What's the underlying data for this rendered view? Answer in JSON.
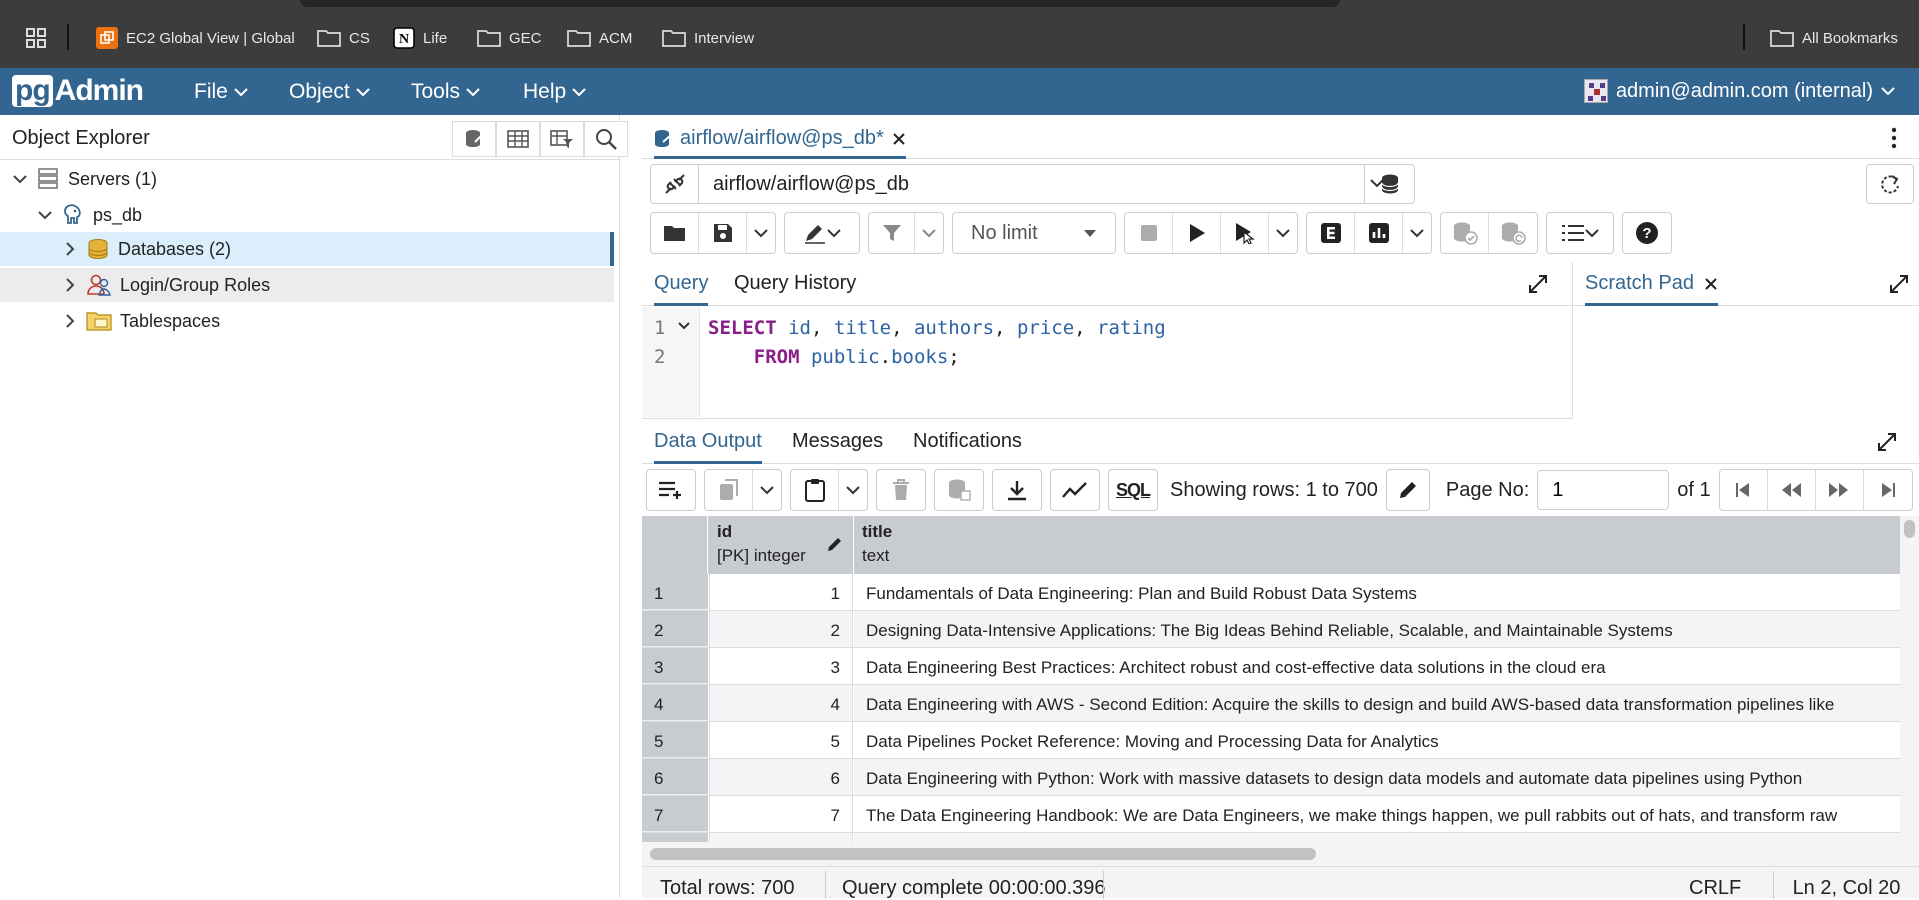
{
  "bookmarks": {
    "items": [
      {
        "label": "EC2 Global View | Global"
      },
      {
        "label": "CS"
      },
      {
        "label": "Life"
      },
      {
        "label": "GEC"
      },
      {
        "label": "ACM"
      },
      {
        "label": "Interview"
      }
    ],
    "all_bookmarks": "All Bookmarks"
  },
  "header": {
    "logo_pg": "pg",
    "logo_admin": "Admin",
    "menus": [
      "File",
      "Object",
      "Tools",
      "Help"
    ],
    "user": "admin@admin.com (internal)"
  },
  "explorer": {
    "title": "Object Explorer",
    "tree": {
      "servers": "Servers (1)",
      "server": "ps_db",
      "databases": "Databases (2)",
      "roles": "Login/Group Roles",
      "tablespaces": "Tablespaces"
    }
  },
  "query_tool": {
    "tab_title": "airflow/airflow@ps_db*",
    "connection": "airflow/airflow@ps_db",
    "limit": "No limit",
    "tabs": {
      "query": "Query",
      "history": "Query History",
      "scratch": "Scratch Pad"
    },
    "code": {
      "line1": {
        "num": "1",
        "kw": "SELECT",
        "cols": [
          "id",
          "title",
          "authors",
          "price",
          "rating"
        ]
      },
      "line2": {
        "num": "2",
        "kw": "FROM",
        "schema": "public",
        "table": "books"
      }
    }
  },
  "results": {
    "tabs": {
      "data": "Data Output",
      "messages": "Messages",
      "notifications": "Notifications"
    },
    "sql_label": "SQL",
    "showing": "Showing rows: 1 to 700",
    "page_label": "Page No:",
    "page_value": "1",
    "of": "of 1",
    "columns": [
      {
        "name": "id",
        "type": "[PK] integer"
      },
      {
        "name": "title",
        "type": "text"
      }
    ],
    "rows": [
      {
        "n": "1",
        "id": "1",
        "title": "Fundamentals of Data Engineering: Plan and Build Robust Data Systems"
      },
      {
        "n": "2",
        "id": "2",
        "title": "Designing Data-Intensive Applications: The Big Ideas Behind Reliable, Scalable, and Maintainable Systems"
      },
      {
        "n": "3",
        "id": "3",
        "title": "Data Engineering Best Practices: Architect robust and cost-effective data solutions in the cloud era"
      },
      {
        "n": "4",
        "id": "4",
        "title": "Data Engineering with AWS - Second Edition: Acquire the skills to design and build AWS-based data transformation pipelines like"
      },
      {
        "n": "5",
        "id": "5",
        "title": "Data Pipelines Pocket Reference: Moving and Processing Data for Analytics"
      },
      {
        "n": "6",
        "id": "6",
        "title": "Data Engineering with Python: Work with massive datasets to design data models and automate data pipelines using Python"
      },
      {
        "n": "7",
        "id": "7",
        "title": "The Data Engineering Handbook: We are Data Engineers, we make things happen, we pull rabbits out of hats, and transform raw"
      }
    ]
  },
  "status": {
    "total": "Total rows: 700",
    "complete": "Query complete 00:00:00.396",
    "eol": "CRLF",
    "pos": "Ln 2, Col 20"
  },
  "colors": {
    "brand": "#326690",
    "chrome": "#3c3c3c"
  }
}
